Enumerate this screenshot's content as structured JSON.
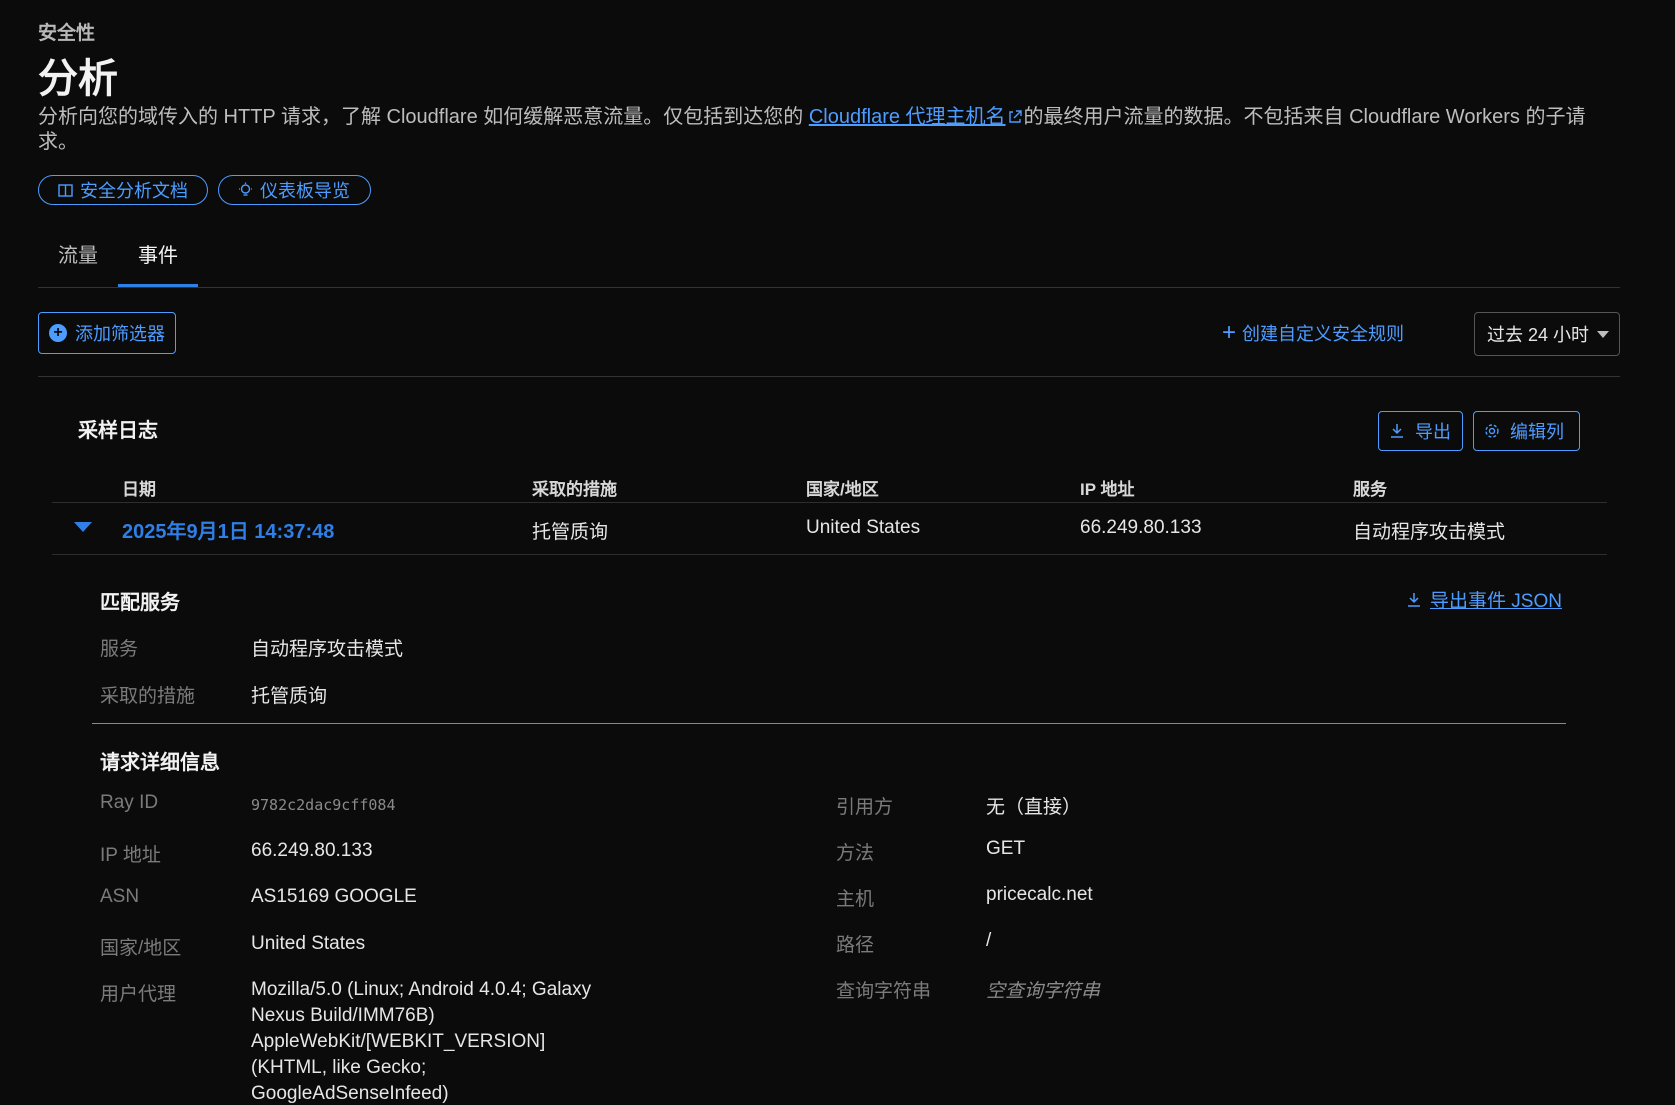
{
  "header": {
    "eyebrow": "安全性",
    "title": "分析",
    "desc_before": "分析向您的域传入的 HTTP 请求，了解 Cloudflare 如何缓解恶意流量。仅包括到达您的 ",
    "desc_link": "Cloudflare 代理主机名",
    "desc_after": "的最终用户流量的数据。不包括来自 Cloudflare Workers 的子请求。",
    "docs_button": "安全分析文档",
    "tour_button": "仪表板导览"
  },
  "tabs": [
    {
      "label": "流量",
      "active": false
    },
    {
      "label": "事件",
      "active": true
    }
  ],
  "toolbar": {
    "add_filter": "添加筛选器",
    "create_rule": "创建自定义安全规则",
    "time_range": "过去 24 小时"
  },
  "log": {
    "title": "采样日志",
    "export": "导出",
    "edit_columns": "编辑列",
    "columns": [
      "日期",
      "采取的措施",
      "国家/地区",
      "IP 地址",
      "服务"
    ],
    "row": {
      "date": "2025年9月1日 14:37:48",
      "action": "托管质询",
      "country": "United States",
      "ip": "66.249.80.133",
      "service": "自动程序攻击模式"
    }
  },
  "matched": {
    "title": "匹配服务",
    "export_json": "导出事件 JSON",
    "service_label": "服务",
    "service_value": "自动程序攻击模式",
    "action_label": "采取的措施",
    "action_value": "托管质询"
  },
  "details": {
    "title": "请求详细信息",
    "left": {
      "ray_label": "Ray ID",
      "ray_value": "9782c2dac9cff084",
      "ip_label": "IP 地址",
      "ip_value": "66.249.80.133",
      "asn_label": "ASN",
      "asn_value": "AS15169 GOOGLE",
      "country_label": "国家/地区",
      "country_value": "United States",
      "ua_label": "用户代理",
      "ua_value": "Mozilla/5.0 (Linux; Android 4.0.4; Galaxy Nexus Build/IMM76B) AppleWebKit/[WEBKIT_VERSION] (KHTML, like Gecko; GoogleAdSenseInfeed) Chrome/[CHROME_VERSION] Mobile"
    },
    "right": {
      "referer_label": "引用方",
      "referer_value": "无（直接）",
      "method_label": "方法",
      "method_value": "GET",
      "host_label": "主机",
      "host_value": "pricecalc.net",
      "path_label": "路径",
      "path_value": "/",
      "query_label": "查询字符串",
      "query_value": "空查询字符串"
    }
  },
  "colors": {
    "accent": "#4d9cff",
    "tab_underline": "#2f7fe6",
    "background": "#0b0b0c"
  }
}
